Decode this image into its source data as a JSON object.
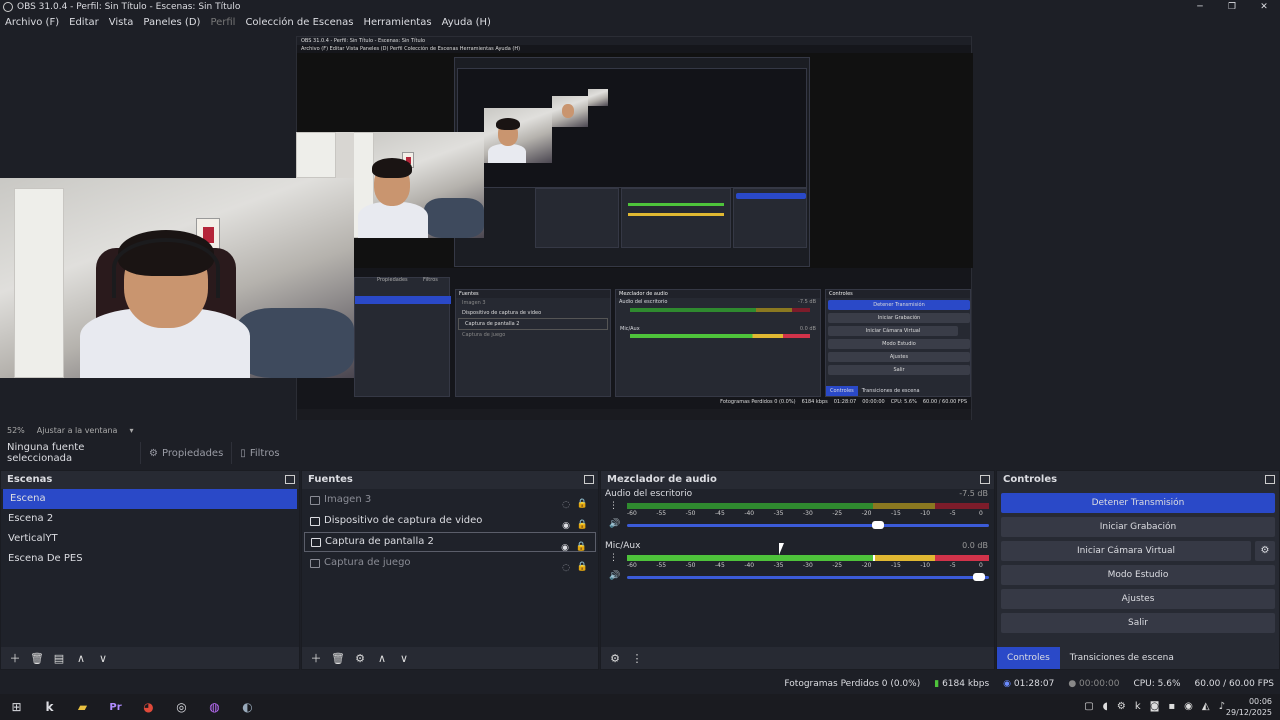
{
  "window": {
    "title": "OBS 31.0.4 - Perfil: Sin Título - Escenas: Sin Título"
  },
  "menu": [
    "Archivo (F)",
    "Editar",
    "Vista",
    "Paneles (D)",
    "Perfil",
    "Colección de Escenas",
    "Herramientas",
    "Ayuda (H)"
  ],
  "zoom": {
    "percent": "52%",
    "mode": "Ajustar a la ventana"
  },
  "props_bar": {
    "none_selected": "Ninguna fuente seleccionada",
    "properties": "Propiedades",
    "filters": "Filtros"
  },
  "scenes": {
    "title": "Escenas",
    "items": [
      "Escena",
      "Escena 2",
      "VerticalYT",
      "Escena De PES"
    ],
    "selected": 0
  },
  "sources": {
    "title": "Fuentes",
    "items": [
      {
        "label": "Imagen 3",
        "visible": false
      },
      {
        "label": "Dispositivo de captura de video",
        "visible": true
      },
      {
        "label": "Captura de pantalla 2",
        "visible": true,
        "selected": true
      },
      {
        "label": "Captura de juego",
        "visible": false
      }
    ]
  },
  "mixer": {
    "title": "Mezclador de audio",
    "channels": [
      {
        "name": "Audio del escritorio",
        "db": "-7.5 dB",
        "volume": 0.71,
        "level": 0
      },
      {
        "name": "Mic/Aux",
        "db": "0.0 dB",
        "volume": 0.99,
        "level": 0.68
      }
    ],
    "ticks": [
      "-60",
      "-55",
      "-50",
      "-45",
      "-40",
      "-35",
      "-30",
      "-25",
      "-20",
      "-15",
      "-10",
      "-5",
      "0"
    ]
  },
  "controls": {
    "title": "Controles",
    "buttons": [
      "Detener Transmisión",
      "Iniciar Grabación",
      "Iniciar Cámara Virtual",
      "Modo Estudio",
      "Ajustes",
      "Salir"
    ],
    "tabs": [
      "Controles",
      "Transiciones de escena"
    ]
  },
  "status": {
    "dropped": "Fotogramas Perdidos 0 (0.0%)",
    "bitrate": "6184 kbps",
    "stream_time": "01:28:07",
    "rec_time": "00:00:00",
    "cpu": "CPU: 5.6%",
    "fps": "60.00 / 60.00 FPS"
  },
  "taskbar": {
    "time": "00:06",
    "date": "29/12/2025"
  },
  "nested": {
    "title": "OBS 31.0.4 - Perfil: Sin Título - Escenas: Sin Título",
    "menu": "Archivo (F)  Editar  Vista  Paneles (D)  Perfil  Colección de Escenas  Herramientas  Ayuda (H)",
    "prop_tab": "Propiedades",
    "filter_tab": "Filtros",
    "sources_title": "Fuentes",
    "sources": [
      "Imagen 3",
      "Dispositivo de captura de video",
      "Captura de pantalla 2",
      "Captura de juego"
    ],
    "mixer_title": "Mezclador de audio",
    "ch1": "Audio del escritorio",
    "ch1_db": "-7.5 dB",
    "ch2": "Mic/Aux",
    "ch2_db": "0.0 dB",
    "controls_title": "Controles",
    "buttons": [
      "Detener Transmisión",
      "Iniciar Grabación",
      "Iniciar Cámara Virtual",
      "Modo Estudio",
      "Ajustes",
      "Salir"
    ],
    "tabs": [
      "Controles",
      "Transiciones de escena"
    ],
    "status": "Fotogramas Perdidos 0 (0.0%)",
    "kbps": "6184 kbps",
    "time": "01:28:07",
    "rec": "00:00:00",
    "cpu": "CPU: 5.6%",
    "fps": "60.00 / 60.00 FPS"
  },
  "colors": {
    "accent": "#2a49c8",
    "panel": "#272a33",
    "bg": "#1d1f26"
  }
}
